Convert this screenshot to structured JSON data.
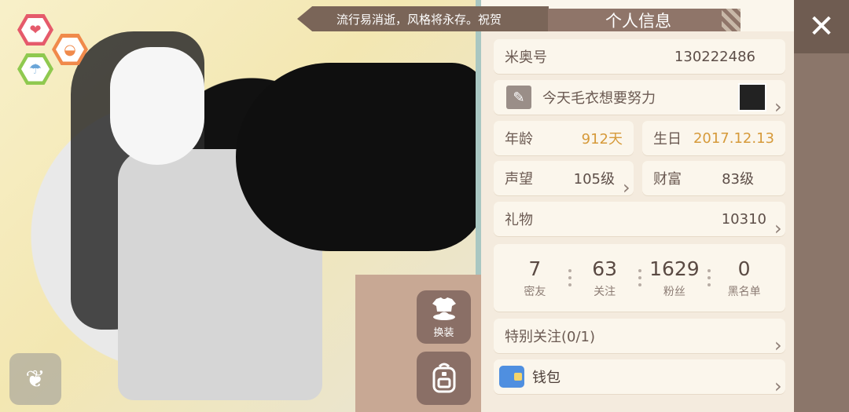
{
  "header": {
    "title": "个人信息",
    "ribbon_text": "流行易消逝，风格将永存。祝贺"
  },
  "status_icons": [
    {
      "name": "heart-icon",
      "glyph": "❤",
      "color": "#e55a6b"
    },
    {
      "name": "stomach-icon",
      "glyph": "◒",
      "color": "#f08a4b"
    },
    {
      "name": "shower-icon",
      "glyph": "☂",
      "color": "#8fc94f"
    }
  ],
  "profile": {
    "id_label": "米奥号",
    "id_value": "130222486",
    "signature": "今天毛衣想要努力",
    "age_label": "年龄",
    "age_value": "912天",
    "birthday_label": "生日",
    "birthday_value": "2017.12.13",
    "reputation_label": "声望",
    "reputation_value": "105级",
    "wealth_label": "财富",
    "wealth_value": "83级",
    "gifts_label": "礼物",
    "gifts_value": "10310"
  },
  "stats": [
    {
      "value": "7",
      "label": "密友"
    },
    {
      "value": "63",
      "label": "关注"
    },
    {
      "value": "1629",
      "label": "粉丝"
    },
    {
      "value": "0",
      "label": "黑名单"
    }
  ],
  "special_follow_label": "特别关注(0/1)",
  "wallet_label": "钱包",
  "buttons": {
    "outfit_label": "换装"
  },
  "colors": {
    "accent_gold": "#d69a3a",
    "panel_bg": "#f4ebde",
    "header_brown": "#8f7569"
  }
}
